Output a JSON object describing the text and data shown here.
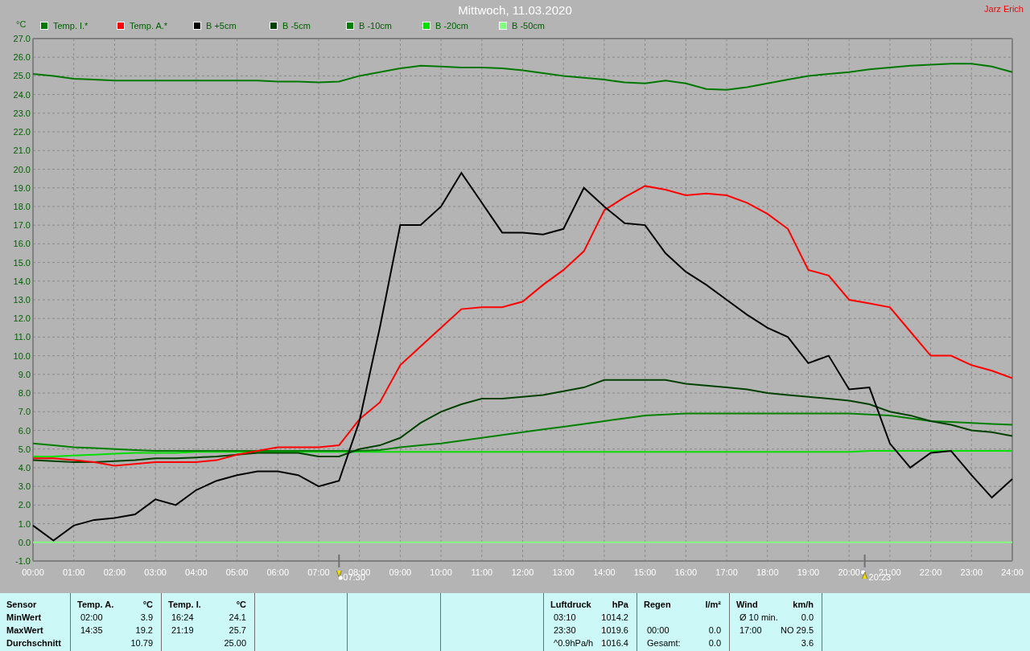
{
  "title": "Mittwoch, 11.03.2020",
  "author": "Jarz Erich",
  "chart_data": {
    "type": "line",
    "ylabel": "°C",
    "x": [
      0,
      0.5,
      1,
      1.5,
      2,
      2.5,
      3,
      3.5,
      4,
      4.5,
      5,
      5.5,
      6,
      6.5,
      7,
      7.5,
      8,
      8.5,
      9,
      9.5,
      10,
      10.5,
      11,
      11.5,
      12,
      12.5,
      13,
      13.5,
      14,
      14.5,
      15,
      15.5,
      16,
      16.5,
      17,
      17.5,
      18,
      18.5,
      19,
      19.5,
      20,
      20.5,
      21,
      21.5,
      22,
      22.5,
      23,
      23.5,
      24
    ],
    "xlim": [
      0,
      24
    ],
    "ylim": [
      -1,
      27
    ],
    "xticks": [
      {
        "value": 0,
        "label": "00:00"
      },
      {
        "value": 1,
        "label": "01:00"
      },
      {
        "value": 2,
        "label": "02:00"
      },
      {
        "value": 3,
        "label": "03:00"
      },
      {
        "value": 4,
        "label": "04:00"
      },
      {
        "value": 5,
        "label": "05:00"
      },
      {
        "value": 6,
        "label": "06:00"
      },
      {
        "value": 7,
        "label": "07:00"
      },
      {
        "value": 8,
        "label": "08:00"
      },
      {
        "value": 9,
        "label": "09:00"
      },
      {
        "value": 10,
        "label": "10:00"
      },
      {
        "value": 11,
        "label": "11:00"
      },
      {
        "value": 12,
        "label": "12:00"
      },
      {
        "value": 13,
        "label": "13:00"
      },
      {
        "value": 14,
        "label": "14:00"
      },
      {
        "value": 15,
        "label": "15:00"
      },
      {
        "value": 16,
        "label": "16:00"
      },
      {
        "value": 17,
        "label": "17:00"
      },
      {
        "value": 18,
        "label": "18:00"
      },
      {
        "value": 19,
        "label": "19:00"
      },
      {
        "value": 20,
        "label": "20:00"
      },
      {
        "value": 21,
        "label": "21:00"
      },
      {
        "value": 22,
        "label": "22:00"
      },
      {
        "value": 23,
        "label": "23:00"
      },
      {
        "value": 24,
        "label": "24:00"
      }
    ],
    "yticks": [
      {
        "value": -1,
        "label": "-1.0"
      },
      {
        "value": 0,
        "label": "0.0"
      },
      {
        "value": 1,
        "label": "1.0"
      },
      {
        "value": 2,
        "label": "2.0"
      },
      {
        "value": 3,
        "label": "3.0"
      },
      {
        "value": 4,
        "label": "4.0"
      },
      {
        "value": 5,
        "label": "5.0"
      },
      {
        "value": 6,
        "label": "6.0"
      },
      {
        "value": 7,
        "label": "7.0"
      },
      {
        "value": 8,
        "label": "8.0"
      },
      {
        "value": 9,
        "label": "9.0"
      },
      {
        "value": 10,
        "label": "10.0"
      },
      {
        "value": 11,
        "label": "11.0"
      },
      {
        "value": 12,
        "label": "12.0"
      },
      {
        "value": 13,
        "label": "13.0"
      },
      {
        "value": 14,
        "label": "14.0"
      },
      {
        "value": 15,
        "label": "15.0"
      },
      {
        "value": 16,
        "label": "16.0"
      },
      {
        "value": 17,
        "label": "17.0"
      },
      {
        "value": 18,
        "label": "18.0"
      },
      {
        "value": 19,
        "label": "19.0"
      },
      {
        "value": 20,
        "label": "20.0"
      },
      {
        "value": 21,
        "label": "21.0"
      },
      {
        "value": 22,
        "label": "22.0"
      },
      {
        "value": 23,
        "label": "23.0"
      },
      {
        "value": 24,
        "label": "24.0"
      },
      {
        "value": 25,
        "label": "25.0"
      },
      {
        "value": 26,
        "label": "26.0"
      },
      {
        "value": 27,
        "label": "27.0"
      }
    ],
    "series": [
      {
        "name": "Temp. I.*",
        "color": "#007800",
        "values": [
          25.1,
          25.0,
          24.85,
          24.8,
          24.75,
          24.75,
          24.75,
          24.75,
          24.75,
          24.75,
          24.75,
          24.75,
          24.7,
          24.7,
          24.65,
          24.7,
          25.0,
          25.2,
          25.4,
          25.55,
          25.5,
          25.45,
          25.45,
          25.4,
          25.3,
          25.15,
          25.0,
          24.9,
          24.8,
          24.65,
          24.6,
          24.75,
          24.6,
          24.3,
          24.25,
          24.4,
          24.6,
          24.8,
          25.0,
          25.1,
          25.2,
          25.35,
          25.45,
          25.55,
          25.6,
          25.65,
          25.65,
          25.5,
          25.2
        ]
      },
      {
        "name": "Temp. A.*",
        "color": "#ff0000",
        "values": [
          4.5,
          4.5,
          4.4,
          4.3,
          4.1,
          4.2,
          4.3,
          4.3,
          4.3,
          4.4,
          4.7,
          4.9,
          5.1,
          5.1,
          5.1,
          5.2,
          6.6,
          7.5,
          9.5,
          10.5,
          11.5,
          12.5,
          12.6,
          12.6,
          12.9,
          13.8,
          14.6,
          15.6,
          17.8,
          18.5,
          19.1,
          18.9,
          18.6,
          18.7,
          18.6,
          18.2,
          17.6,
          16.8,
          14.6,
          14.3,
          13.0,
          12.8,
          12.6,
          11.3,
          10.0,
          10.0,
          9.5,
          9.2,
          8.8
        ]
      },
      {
        "name": "B +5cm",
        "color": "#000000",
        "values": [
          0.9,
          0.1,
          0.9,
          1.2,
          1.3,
          1.5,
          2.3,
          2.0,
          2.8,
          3.3,
          3.6,
          3.8,
          3.8,
          3.6,
          3.0,
          3.3,
          6.5,
          11.5,
          17.0,
          17.0,
          18.0,
          19.8,
          18.2,
          16.6,
          16.6,
          16.5,
          16.8,
          19.0,
          18.0,
          17.1,
          17.0,
          15.5,
          14.5,
          13.8,
          13.0,
          12.2,
          11.5,
          11.0,
          9.6,
          10.0,
          8.2,
          8.3,
          5.3,
          4.0,
          4.8,
          4.9,
          3.6,
          2.4,
          3.4
        ]
      },
      {
        "name": "B -5cm",
        "color": "#004000",
        "values": [
          4.4,
          4.35,
          4.3,
          4.3,
          4.35,
          4.4,
          4.5,
          4.5,
          4.55,
          4.6,
          4.7,
          4.8,
          4.8,
          4.8,
          4.6,
          4.6,
          5.0,
          5.2,
          5.6,
          6.4,
          7.0,
          7.4,
          7.7,
          7.7,
          7.8,
          7.9,
          8.1,
          8.3,
          8.7,
          8.7,
          8.7,
          8.7,
          8.5,
          8.4,
          8.3,
          8.2,
          8.0,
          7.9,
          7.8,
          7.7,
          7.6,
          7.4,
          7.0,
          6.8,
          6.5,
          6.3,
          6.0,
          5.9,
          5.7
        ]
      },
      {
        "name": "B -10cm",
        "color": "#008000",
        "values": [
          5.3,
          5.2,
          5.1,
          5.05,
          5.0,
          4.95,
          4.9,
          4.9,
          4.9,
          4.9,
          4.9,
          4.9,
          4.9,
          4.9,
          4.9,
          4.9,
          4.9,
          4.95,
          5.1,
          5.2,
          5.3,
          5.45,
          5.6,
          5.75,
          5.9,
          6.05,
          6.2,
          6.35,
          6.5,
          6.65,
          6.8,
          6.85,
          6.9,
          6.9,
          6.9,
          6.9,
          6.9,
          6.9,
          6.9,
          6.9,
          6.9,
          6.85,
          6.8,
          6.65,
          6.5,
          6.45,
          6.4,
          6.35,
          6.3
        ]
      },
      {
        "name": "B -20cm",
        "color": "#00e000",
        "values": [
          4.6,
          4.6,
          4.65,
          4.7,
          4.75,
          4.8,
          4.8,
          4.8,
          4.85,
          4.85,
          4.85,
          4.85,
          4.85,
          4.85,
          4.85,
          4.85,
          4.85,
          4.85,
          4.85,
          4.85,
          4.85,
          4.85,
          4.85,
          4.85,
          4.85,
          4.85,
          4.85,
          4.85,
          4.85,
          4.85,
          4.85,
          4.85,
          4.85,
          4.85,
          4.85,
          4.85,
          4.85,
          4.85,
          4.85,
          4.85,
          4.85,
          4.9,
          4.9,
          4.9,
          4.9,
          4.9,
          4.9,
          4.9,
          4.9
        ]
      },
      {
        "name": "B -50cm",
        "color": "#80ff80",
        "values": [
          0,
          0,
          0,
          0,
          0,
          0,
          0,
          0,
          0,
          0,
          0,
          0,
          0,
          0,
          0,
          0,
          0,
          0,
          0,
          0,
          0,
          0,
          0,
          0,
          0,
          0,
          0,
          0,
          0,
          0,
          0,
          0,
          0,
          0,
          0,
          0,
          0,
          0,
          0,
          0,
          0,
          0,
          0,
          0,
          0,
          0,
          0,
          0,
          0
        ]
      }
    ],
    "grid": true
  },
  "sun_events": [
    {
      "kind": "sunrise",
      "time": "07:30"
    },
    {
      "kind": "sunset",
      "time": "20:23"
    }
  ],
  "stats": {
    "row_labels": [
      "Sensor",
      "MinWert",
      "MaxWert",
      "Durchschnitt"
    ],
    "left_groups": [
      {
        "title": "Temp. A.",
        "unit": "°C",
        "rows": [
          {
            "time": "02:00",
            "value": "3.9"
          },
          {
            "time": "14:35",
            "value": "19.2"
          },
          {
            "value": "10.79"
          }
        ]
      },
      {
        "title": "Temp. I.",
        "unit": "°C",
        "rows": [
          {
            "time": "16:24",
            "value": "24.1"
          },
          {
            "time": "21:19",
            "value": "25.7"
          },
          {
            "value": "25.00"
          }
        ]
      }
    ],
    "right_groups": [
      {
        "title": "Luftdruck",
        "unit": "hPa",
        "rows": [
          {
            "time": "03:10",
            "value": "1014.2"
          },
          {
            "time": "23:30",
            "value": "1019.6"
          },
          {
            "time": "^0.9hPa/h",
            "value": "1016.4"
          }
        ]
      },
      {
        "title": "Regen",
        "unit": "l/m²",
        "rows": [
          {},
          {
            "time": "00:00",
            "value": "0.0"
          },
          {
            "time": "Gesamt:",
            "value": "0.0"
          }
        ]
      },
      {
        "title": "Wind",
        "unit": "km/h",
        "rows": [
          {
            "time": "Ø 10 min.",
            "value": "0.0"
          },
          {
            "time": "17:00",
            "value": "NO 29.5"
          },
          {
            "value": "3.6"
          }
        ]
      }
    ]
  }
}
